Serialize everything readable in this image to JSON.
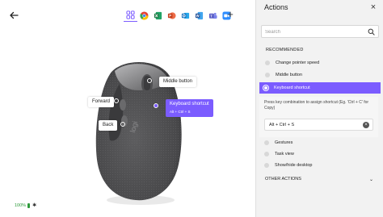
{
  "header": {
    "back_icon": "arrow-left-icon",
    "add_icon": "+",
    "apps": [
      {
        "name": "all-apps",
        "icon": "grid-icon",
        "color": "#7b5cff",
        "selected": true
      },
      {
        "name": "chrome",
        "icon": "chrome-icon",
        "color": "#e44134"
      },
      {
        "name": "excel",
        "icon": "excel-icon",
        "color": "#1f7a45"
      },
      {
        "name": "powerpoint",
        "icon": "powerpoint-icon",
        "color": "#d04423"
      },
      {
        "name": "outlook",
        "icon": "outlook-icon",
        "color": "#0f6cbd"
      },
      {
        "name": "word",
        "icon": "word-icon",
        "color": "#2b579a"
      },
      {
        "name": "teams",
        "icon": "teams-icon",
        "color": "#5b5fc7"
      },
      {
        "name": "zoom",
        "icon": "zoom-icon",
        "color": "#2d8cff"
      }
    ]
  },
  "mouse": {
    "callouts": {
      "middle": "Middle button",
      "forward": "Forward",
      "back": "Back",
      "keyboard_title": "Keyboard shortcut",
      "keyboard_sub": "Alt + Ctrl + S"
    }
  },
  "status": {
    "battery": "100%",
    "battery_color": "#2d9a3a"
  },
  "panel": {
    "title": "Actions",
    "close_icon": "×",
    "search_placeholder": "Search",
    "recommended_label": "RECOMMENDED",
    "actions": [
      {
        "label": "Change pointer speed"
      },
      {
        "label": "Middle button"
      },
      {
        "label": "Keyboard shortcut",
        "selected": true
      },
      {
        "label": "Gestures"
      },
      {
        "label": "Task view"
      },
      {
        "label": "Show/hide desktop"
      }
    ],
    "hint": "Press key combination to assign shortcut (Eg. 'Ctrl + C' for Copy)",
    "shortcut_value": "Alt + Ctrl + S",
    "clear_icon": "×",
    "other_actions_label": "OTHER ACTIONS",
    "chevron": "⌄",
    "accent": "#7b5cff"
  }
}
